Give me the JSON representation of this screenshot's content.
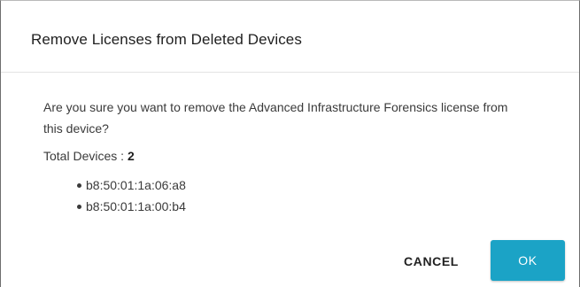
{
  "dialog": {
    "title": "Remove Licenses from Deleted Devices",
    "message": "Are you sure you want to remove the Advanced Infrastructure Forensics license from this device?",
    "total_label": "Total Devices : ",
    "total_count": "2",
    "devices": [
      "b8:50:01:1a:06:a8",
      "b8:50:01:1a:00:b4"
    ],
    "cancel_label": "CANCEL",
    "ok_label": "OK"
  },
  "colors": {
    "accent": "#1ba3c6",
    "text": "#2b2b2b"
  }
}
